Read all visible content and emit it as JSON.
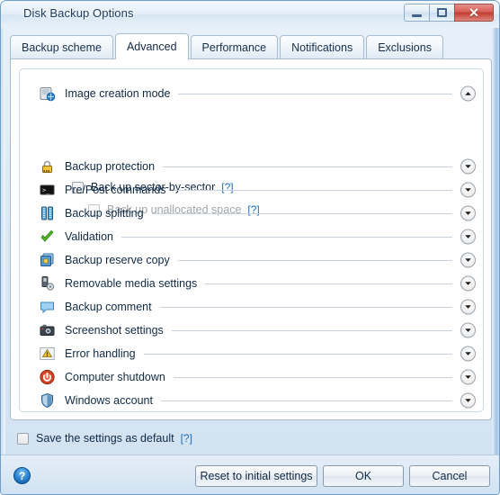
{
  "window": {
    "title": "Disk Backup Options",
    "controls": {
      "minimize": "–",
      "maximize": "□",
      "close": "✕"
    }
  },
  "tabs": [
    {
      "label": "Backup scheme",
      "active": false
    },
    {
      "label": "Advanced",
      "active": true
    },
    {
      "label": "Performance",
      "active": false
    },
    {
      "label": "Notifications",
      "active": false
    },
    {
      "label": "Exclusions",
      "active": false
    }
  ],
  "sections": [
    {
      "label": "Image creation mode",
      "icon": "disk-image-icon",
      "expanded": true,
      "chevron": "chevron-up-icon"
    },
    {
      "label": "Backup protection",
      "icon": "padlock-icon",
      "expanded": false,
      "chevron": "chevron-down-icon"
    },
    {
      "label": "Pre/Post commands",
      "icon": "console-icon",
      "expanded": false,
      "chevron": "chevron-down-icon"
    },
    {
      "label": "Backup splitting",
      "icon": "split-archive-icon",
      "expanded": false,
      "chevron": "chevron-down-icon"
    },
    {
      "label": "Validation",
      "icon": "green-check-icon",
      "expanded": false,
      "chevron": "chevron-down-icon"
    },
    {
      "label": "Backup reserve copy",
      "icon": "reserve-copy-icon",
      "expanded": false,
      "chevron": "chevron-down-icon"
    },
    {
      "label": "Removable media settings",
      "icon": "usb-settings-icon",
      "expanded": false,
      "chevron": "chevron-down-icon"
    },
    {
      "label": "Backup comment",
      "icon": "comment-bubble-icon",
      "expanded": false,
      "chevron": "chevron-down-icon"
    },
    {
      "label": "Screenshot settings",
      "icon": "camera-icon",
      "expanded": false,
      "chevron": "chevron-down-icon"
    },
    {
      "label": "Error handling",
      "icon": "warning-triangle-icon",
      "expanded": false,
      "chevron": "chevron-down-icon"
    },
    {
      "label": "Computer shutdown",
      "icon": "power-icon",
      "expanded": false,
      "chevron": "chevron-down-icon"
    },
    {
      "label": "Windows account",
      "icon": "shield-icon",
      "expanded": false,
      "chevron": "chevron-down-icon"
    }
  ],
  "image_creation_mode": {
    "sector_by_sector": {
      "label": "Back up sector-by-sector",
      "checked": false,
      "enabled": true,
      "help": "[?]"
    },
    "unallocated_space": {
      "label": "Back up unallocated space",
      "checked": false,
      "enabled": false,
      "help": "[?]"
    }
  },
  "save_default": {
    "label": "Save the settings as default",
    "checked": false,
    "help": "[?]"
  },
  "footer": {
    "help_icon": "help-question-icon",
    "reset_label": "Reset to initial settings",
    "ok_label": "OK",
    "cancel_label": "Cancel"
  },
  "colors": {
    "accent": "#1a6fc4",
    "title_text": "#1b3b5f",
    "close_button": "#c13c31",
    "panel_border": "#a7bdd2"
  }
}
